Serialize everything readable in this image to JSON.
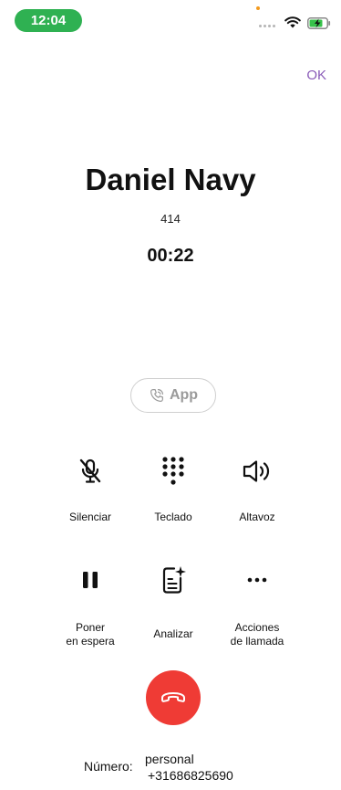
{
  "status_bar": {
    "time": "12:04"
  },
  "header": {
    "ok_label": "OK"
  },
  "call": {
    "name": "Daniel Navy",
    "extension": "414",
    "timer": "00:22"
  },
  "app_button": {
    "label": "App"
  },
  "controls": {
    "mute": "Silenciar",
    "keypad": "Teclado",
    "speaker": "Altavoz",
    "hold_line1": "Poner",
    "hold_line2": "en espera",
    "analyze": "Analizar",
    "actions_line1": "Acciones",
    "actions_line2": "de llamada"
  },
  "number": {
    "label": "Número:",
    "type": "personal",
    "value": "+31686825690"
  },
  "colors": {
    "time_pill": "#2fb152",
    "ok_accent": "#8a5bb8",
    "end_call": "#ef3b35",
    "app_border": "#cfcfcf"
  },
  "icons": {
    "mute": "mic-off-icon",
    "keypad": "keypad-icon",
    "speaker": "speaker-icon",
    "hold": "pause-icon",
    "analyze": "document-sparkle-icon",
    "actions": "more-horizontal-icon",
    "end_call": "phone-hangup-icon",
    "app": "phone-icon"
  }
}
